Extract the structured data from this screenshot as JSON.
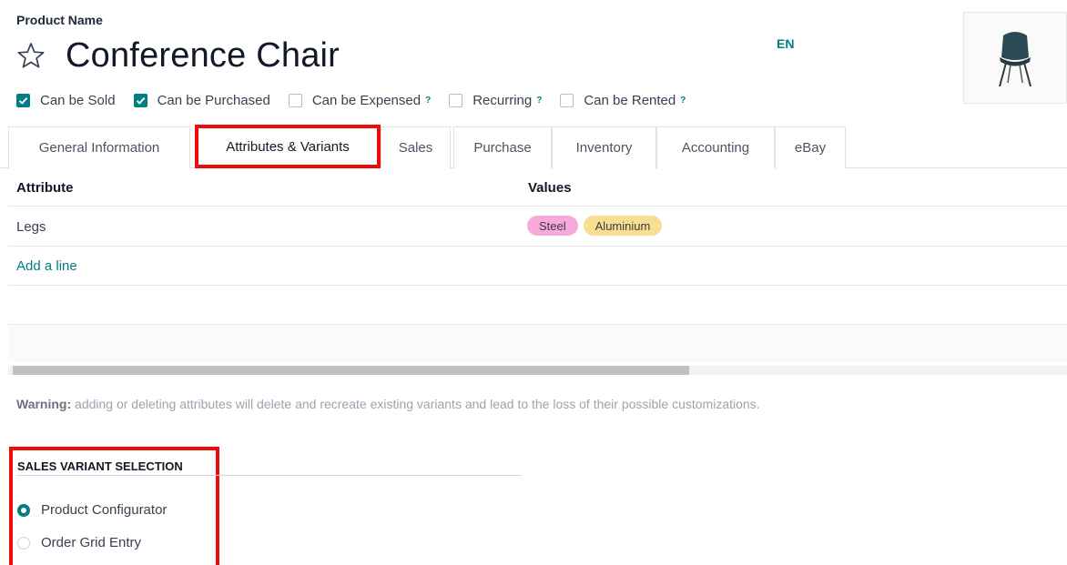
{
  "header": {
    "field_label": "Product Name",
    "product_name": "Conference Chair",
    "language": "EN"
  },
  "options": [
    {
      "label": "Can be Sold",
      "checked": true,
      "help": ""
    },
    {
      "label": "Can be Purchased",
      "checked": true,
      "help": ""
    },
    {
      "label": "Can be Expensed",
      "checked": false,
      "help": "?"
    },
    {
      "label": "Recurring",
      "checked": false,
      "help": "?"
    },
    {
      "label": "Can be Rented",
      "checked": false,
      "help": "?"
    }
  ],
  "tabs": [
    {
      "label": "General Information"
    },
    {
      "label": "Attributes & Variants"
    },
    {
      "label": "Sales"
    },
    {
      "label": "Purchase"
    },
    {
      "label": "Inventory"
    },
    {
      "label": "Accounting"
    },
    {
      "label": "eBay"
    }
  ],
  "active_tab": "Attributes & Variants",
  "table": {
    "headers": {
      "attribute": "Attribute",
      "values": "Values"
    },
    "rows": [
      {
        "attribute": "Legs",
        "values": [
          {
            "label": "Steel",
            "color": "#f7aadb"
          },
          {
            "label": "Aluminium",
            "color": "#f8de92"
          }
        ]
      }
    ],
    "add_line": "Add a line"
  },
  "warning": {
    "prefix": "Warning:",
    "text": " adding or deleting attributes will delete and recreate existing variants and lead to the loss of their possible customizations."
  },
  "sales_variant": {
    "title": "SALES VARIANT SELECTION",
    "options": [
      {
        "label": "Product Configurator",
        "selected": true
      },
      {
        "label": "Order Grid Entry",
        "selected": false
      }
    ]
  },
  "colors": {
    "accent": "#017e84",
    "highlight": "#ee0b0b"
  }
}
